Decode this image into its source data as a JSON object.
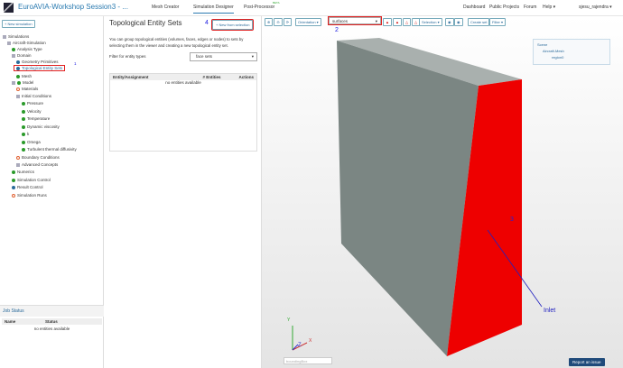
{
  "header": {
    "title": "EuroAVIA-Workshop Session3 - ...",
    "nav": [
      "Mesh Creator",
      "Simulation Designer",
      "Post-Processor"
    ],
    "beta": "BETA",
    "right": [
      "Dashboard",
      "Public Projects",
      "Forum",
      "Help ▾",
      "sjesu_rajendra ▾"
    ]
  },
  "left": {
    "new_sim": "+ New simulation",
    "tree": [
      "Simulations",
      "Aircraft-Simulation",
      "Analysis Type",
      "Domain",
      "Geometry Primitives",
      "Topological Entity Sets",
      "Mesh",
      "Model",
      "Materials",
      "Initial Conditions",
      "Pressure",
      "Velocity",
      "Temperature",
      "Dynamic viscosity",
      "k",
      "Omega",
      "Turbulent thermal diffusivity",
      "Boundary Conditions",
      "Advanced Concepts",
      "Numerics",
      "Simulation Control",
      "Result Control",
      "Simulation Runs"
    ],
    "job_status": {
      "title": "Job Status",
      "cols": [
        "Name",
        "Status"
      ],
      "empty": "no entities available"
    }
  },
  "mid": {
    "title": "Topological Entity Sets",
    "new_btn": "+ New from selection",
    "desc": "You can group topological entities (volumes, faces, edges or nodes) to sets by selecting them in the viewer and creating a new topological entity set.",
    "filter_label": "Filter for entity types",
    "filter_value": "face sets",
    "cols": [
      "Entity/Assignment",
      "# Entities",
      "Actions"
    ],
    "empty": "no entities available"
  },
  "viewer": {
    "orientation": "Orientation ▾",
    "mode": "surfaces",
    "selection": "Selection ▾",
    "create_set": "Create set",
    "filter": "Filter ▾",
    "scene": [
      "Scene",
      "Aircraft-Mesh",
      "region0"
    ],
    "bbox": "boundingBox",
    "inlet": "Inlet",
    "report": "Report an issue",
    "axes": [
      "Y",
      "X",
      "Z"
    ]
  },
  "annotations": [
    "1",
    "2",
    "3",
    "4"
  ],
  "colors": {
    "accent": "#2a7ab0",
    "face_red": "#ee0000",
    "face_gray": "#7b8683"
  }
}
